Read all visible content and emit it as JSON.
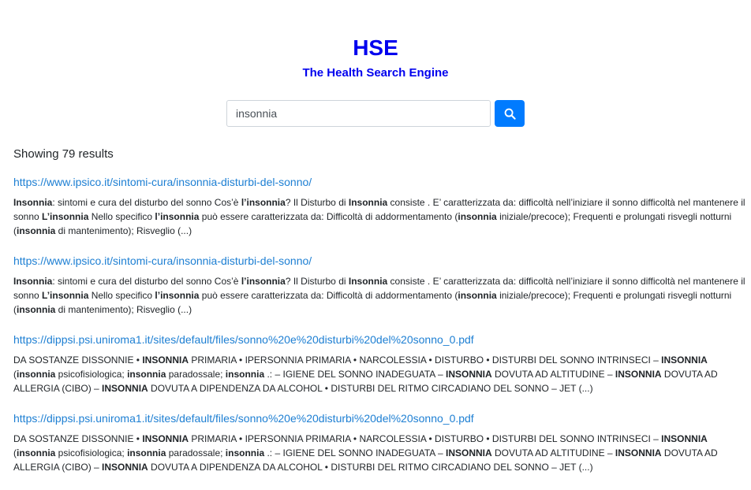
{
  "header": {
    "brand": "HSE",
    "tagline": "The Health Search Engine"
  },
  "search": {
    "value": "insonnia",
    "button_icon": "search-icon",
    "button_color": "#007bff"
  },
  "results_summary": "Showing 79 results",
  "colors": {
    "brand": "#0000ee",
    "link": "#1d7fd3",
    "text": "#212529"
  },
  "results": [
    {
      "url": "https://www.ipsico.it/sintomi-cura/insonnia-disturbi-del-sonno/",
      "snippet": [
        {
          "t": "Insonnia",
          "b": true
        },
        {
          "t": ": sintomi e cura del disturbo del sonno Cos’è ",
          "b": false
        },
        {
          "t": "l’insonnia",
          "b": true
        },
        {
          "t": "? Il Disturbo di ",
          "b": false
        },
        {
          "t": "Insonnia",
          "b": true
        },
        {
          "t": " consiste . E’ caratterizzata da: difficoltà nell’iniziare il sonno difficoltà nel mantenere il sonno ",
          "b": false
        },
        {
          "t": "L’insonnia",
          "b": true
        },
        {
          "t": " Nello specifico ",
          "b": false
        },
        {
          "t": "l’insonnia",
          "b": true
        },
        {
          "t": " può essere caratterizzata da: Difficoltà di addormentamento (",
          "b": false
        },
        {
          "t": "insonnia",
          "b": true
        },
        {
          "t": " iniziale/precoce); Frequenti e prolungati risvegli notturni (",
          "b": false
        },
        {
          "t": "insonnia",
          "b": true
        },
        {
          "t": " di mantenimento); Risveglio (...)",
          "b": false
        }
      ]
    },
    {
      "url": "https://www.ipsico.it/sintomi-cura/insonnia-disturbi-del-sonno/",
      "snippet": [
        {
          "t": "Insonnia",
          "b": true
        },
        {
          "t": ": sintomi e cura del disturbo del sonno Cos’è ",
          "b": false
        },
        {
          "t": "l’insonnia",
          "b": true
        },
        {
          "t": "? Il Disturbo di ",
          "b": false
        },
        {
          "t": "Insonnia",
          "b": true
        },
        {
          "t": " consiste . E’ caratterizzata da: difficoltà nell’iniziare il sonno difficoltà nel mantenere il sonno ",
          "b": false
        },
        {
          "t": "L’insonnia",
          "b": true
        },
        {
          "t": " Nello specifico ",
          "b": false
        },
        {
          "t": "l’insonnia",
          "b": true
        },
        {
          "t": " può essere caratterizzata da: Difficoltà di addormentamento (",
          "b": false
        },
        {
          "t": "insonnia",
          "b": true
        },
        {
          "t": " iniziale/precoce); Frequenti e prolungati risvegli notturni (",
          "b": false
        },
        {
          "t": "insonnia",
          "b": true
        },
        {
          "t": " di mantenimento); Risveglio (...)",
          "b": false
        }
      ]
    },
    {
      "url": "https://dippsi.psi.uniroma1.it/sites/default/files/sonno%20e%20disturbi%20del%20sonno_0.pdf",
      "snippet": [
        {
          "t": "DA SOSTANZE DISSONNIE • ",
          "b": false
        },
        {
          "t": "INSONNIA",
          "b": true
        },
        {
          "t": " PRIMARIA • IPERSONNIA PRIMARIA • NARCOLESSIA • DISTURBO • DISTURBI DEL SONNO INTRINSECI – ",
          "b": false
        },
        {
          "t": "INSONNIA",
          "b": true
        },
        {
          "t": " (",
          "b": false
        },
        {
          "t": "insonnia",
          "b": true
        },
        {
          "t": " psicofisiologica; ",
          "b": false
        },
        {
          "t": "insonnia",
          "b": true
        },
        {
          "t": " paradossale; ",
          "b": false
        },
        {
          "t": "insonnia",
          "b": true
        },
        {
          "t": " .: – IGIENE DEL SONNO INADEGUATA – ",
          "b": false
        },
        {
          "t": "INSONNIA",
          "b": true
        },
        {
          "t": " DOVUTA AD ALTITUDINE – ",
          "b": false
        },
        {
          "t": "INSONNIA",
          "b": true
        },
        {
          "t": " DOVUTA AD ALLERGIA (CIBO) – ",
          "b": false
        },
        {
          "t": "INSONNIA",
          "b": true
        },
        {
          "t": " DOVUTA A DIPENDENZA DA ALCOHOL • DISTURBI DEL RITMO CIRCADIANO DEL SONNO – JET (...)",
          "b": false
        }
      ]
    },
    {
      "url": "https://dippsi.psi.uniroma1.it/sites/default/files/sonno%20e%20disturbi%20del%20sonno_0.pdf",
      "snippet": [
        {
          "t": "DA SOSTANZE DISSONNIE • ",
          "b": false
        },
        {
          "t": "INSONNIA",
          "b": true
        },
        {
          "t": " PRIMARIA • IPERSONNIA PRIMARIA • NARCOLESSIA • DISTURBO • DISTURBI DEL SONNO INTRINSECI – ",
          "b": false
        },
        {
          "t": "INSONNIA",
          "b": true
        },
        {
          "t": " (",
          "b": false
        },
        {
          "t": "insonnia",
          "b": true
        },
        {
          "t": " psicofisiologica; ",
          "b": false
        },
        {
          "t": "insonnia",
          "b": true
        },
        {
          "t": " paradossale; ",
          "b": false
        },
        {
          "t": "insonnia",
          "b": true
        },
        {
          "t": " .: – IGIENE DEL SONNO INADEGUATA – ",
          "b": false
        },
        {
          "t": "INSONNIA",
          "b": true
        },
        {
          "t": " DOVUTA AD ALTITUDINE – ",
          "b": false
        },
        {
          "t": "INSONNIA",
          "b": true
        },
        {
          "t": " DOVUTA AD ALLERGIA (CIBO) – ",
          "b": false
        },
        {
          "t": "INSONNIA",
          "b": true
        },
        {
          "t": " DOVUTA A DIPENDENZA DA ALCOHOL • DISTURBI DEL RITMO CIRCADIANO DEL SONNO – JET (...)",
          "b": false
        }
      ]
    }
  ]
}
